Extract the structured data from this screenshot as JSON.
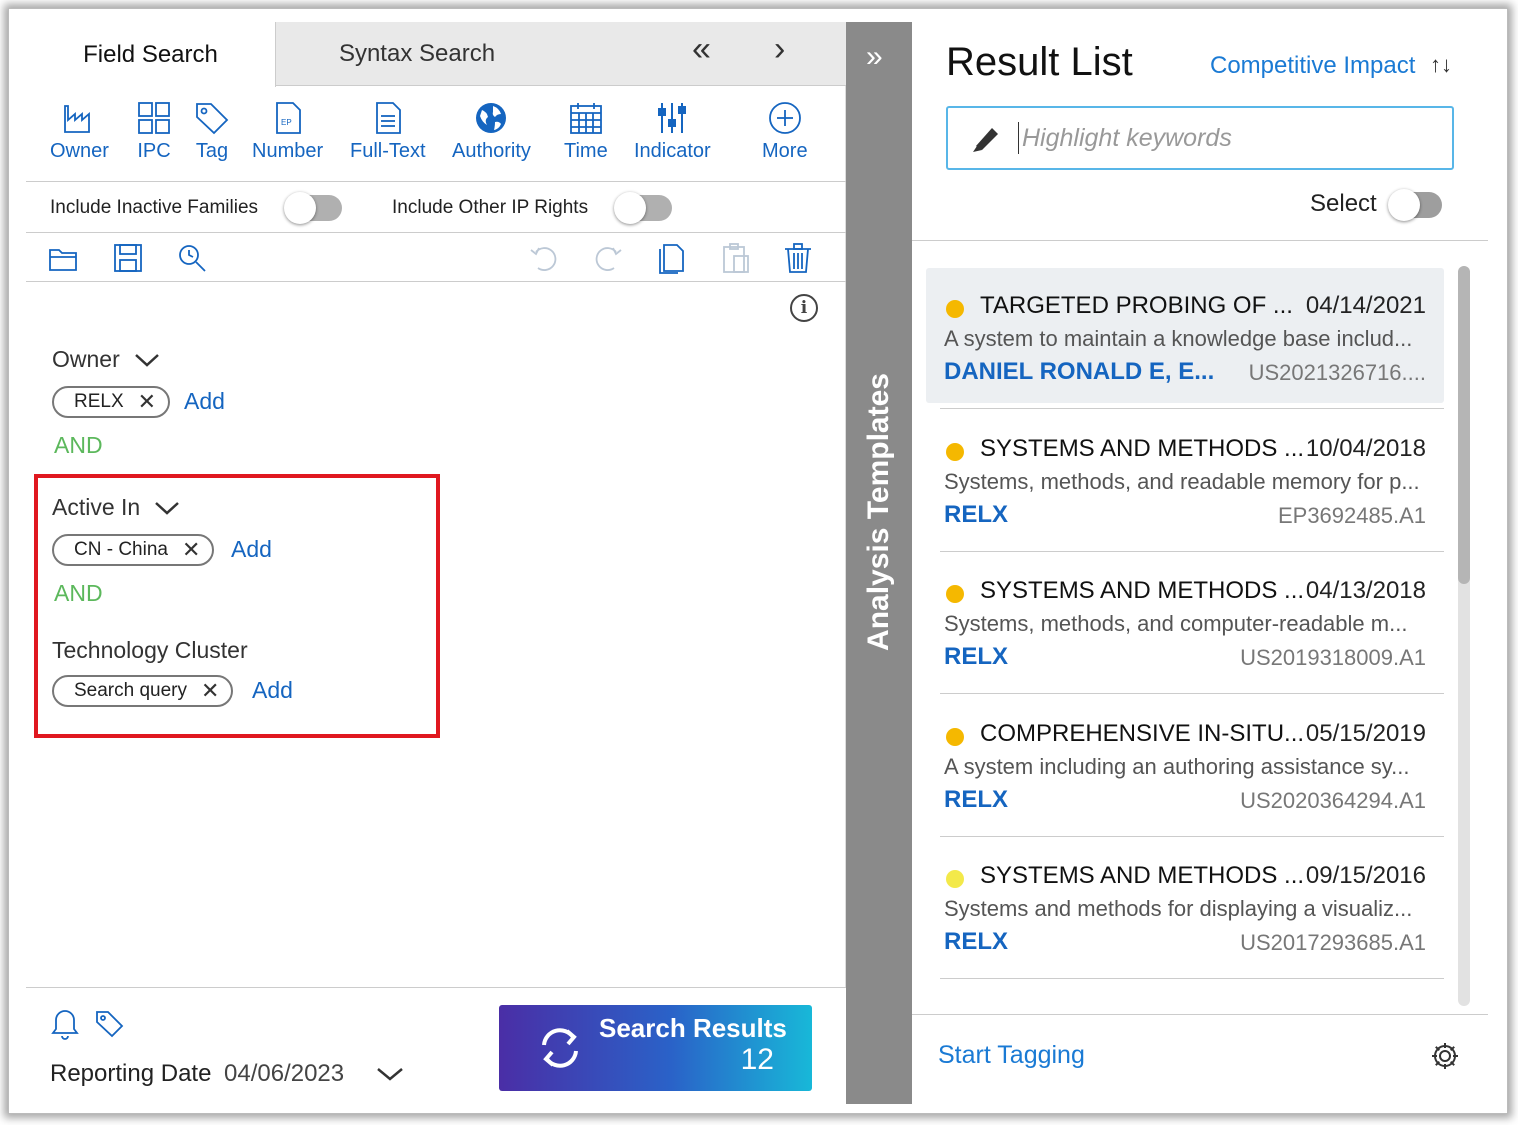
{
  "tabs": {
    "field_search": "Field Search",
    "syntax_search": "Syntax Search",
    "nav_collapse": "«",
    "nav_next": "›"
  },
  "tools": [
    {
      "label": "Owner",
      "icon": "factory-icon"
    },
    {
      "label": "IPC",
      "icon": "grid-icon"
    },
    {
      "label": "Tag",
      "icon": "tag-icon"
    },
    {
      "label": "Number",
      "icon": "ep-document-icon"
    },
    {
      "label": "Full-Text",
      "icon": "document-text-icon"
    },
    {
      "label": "Authority",
      "icon": "globe-icon"
    },
    {
      "label": "Time",
      "icon": "calendar-icon"
    },
    {
      "label": "Indicator",
      "icon": "sliders-icon"
    },
    {
      "label": "More",
      "icon": "plus-circle-icon"
    }
  ],
  "toggles": {
    "inactive_families": "Include Inactive Families",
    "other_ip_rights": "Include Other IP Rights"
  },
  "query": {
    "owner_label": "Owner",
    "owner_chip": "RELX",
    "add": "Add",
    "and": "AND",
    "active_in_label": "Active In",
    "active_in_chip": "CN - China",
    "tech_cluster_label": "Technology Cluster",
    "tech_cluster_chip": "Search query",
    "remove_glyph": "✕"
  },
  "bottom": {
    "reporting_label": "Reporting Date",
    "reporting_date": "04/06/2023",
    "search_button": "Search Results",
    "result_count": "12"
  },
  "strip": {
    "expand": "»",
    "vertical_title": "Analysis Templates"
  },
  "results_panel": {
    "title": "Result List",
    "sort_label": "Competitive Impact",
    "sort_arrows": "↑↓",
    "highlight_placeholder": "Highlight keywords",
    "select_label": "Select",
    "start_tagging": "Start Tagging"
  },
  "results": [
    {
      "title": "TARGETED PROBING OF ...",
      "date": "04/14/2021",
      "desc": "A system to maintain a knowledge base includ...",
      "owner": "DANIEL RONALD E, E...",
      "pub": "US2021326716....",
      "dot": "#f5b800"
    },
    {
      "title": "SYSTEMS AND METHODS ...",
      "date": "10/04/2018",
      "desc": "Systems, methods, and readable memory for p...",
      "owner": "RELX",
      "pub": "EP3692485.A1",
      "dot": "#f5b800"
    },
    {
      "title": "SYSTEMS AND METHODS ...",
      "date": "04/13/2018",
      "desc": "Systems, methods, and computer-readable m...",
      "owner": "RELX",
      "pub": "US2019318009.A1",
      "dot": "#f5b800"
    },
    {
      "title": "COMPREHENSIVE IN-SITU...",
      "date": "05/15/2019",
      "desc": "A system including an authoring assistance sy...",
      "owner": "RELX",
      "pub": "US2020364294.A1",
      "dot": "#f5b800"
    },
    {
      "title": "SYSTEMS AND METHODS ...",
      "date": "09/15/2016",
      "desc": "Systems and methods for displaying a visualiz...",
      "owner": "RELX",
      "pub": "US2017293685.A1",
      "dot": "#f3e94a"
    }
  ],
  "colors": {
    "link_blue": "#1565c0",
    "and_green": "#5cb85c",
    "highlight_red": "#e0181f"
  }
}
